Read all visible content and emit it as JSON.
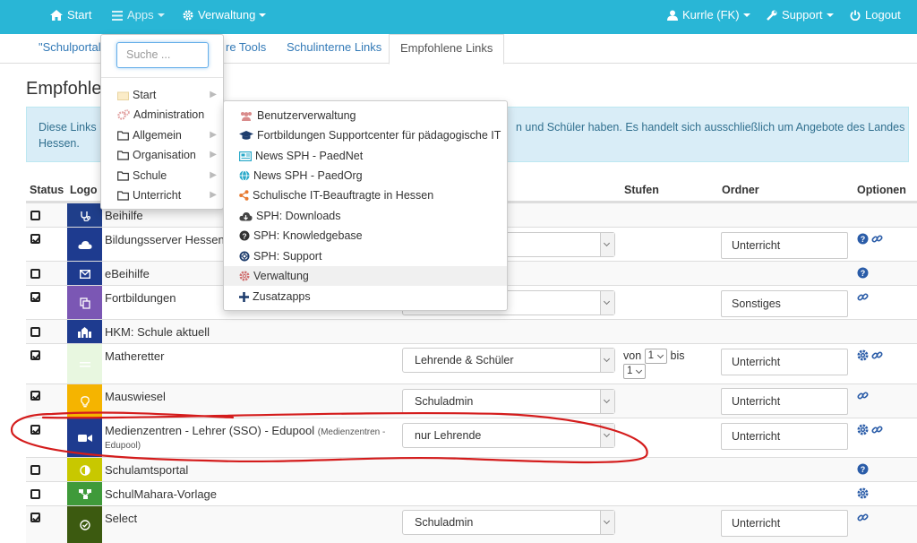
{
  "navbar": {
    "start": "Start",
    "apps": "Apps",
    "verwaltung": "Verwaltung",
    "user": "Kurrle (FK)",
    "support": "Support",
    "logout": "Logout"
  },
  "tabs": [
    {
      "label": "\"Schulportal I"
    },
    {
      "label": "re Tools"
    },
    {
      "label": "Schulinterne Links"
    },
    {
      "label": "Empfohlene Links"
    }
  ],
  "page": {
    "title": "Empfohle",
    "info_line1": "Diese Links k",
    "info_line1_right": "n und Schüler haben. Es handelt sich ausschließlich um Angebote des Landes",
    "info_line2": "Hessen."
  },
  "table": {
    "headers": {
      "status": "Status",
      "logo": "Logo",
      "stufen": "Stufen",
      "ordner": "Ordner",
      "optionen": "Optionen"
    },
    "rows": [
      {
        "name": "Beihilfe",
        "checked": false,
        "logo_color": "#1f3e8a"
      },
      {
        "name": "Bildungsserver Hessen",
        "checked": true,
        "logo_color": "#1e3b8f",
        "ordner": "Unterricht"
      },
      {
        "name": "eBeihilfe",
        "checked": false,
        "logo_color": "#1e3b8f"
      },
      {
        "name": "Fortbildungen",
        "checked": true,
        "logo_color": "#7b57b4",
        "ordner": "Sonstiges"
      },
      {
        "name": "HKM: Schule aktuell",
        "checked": false,
        "logo_color": "#1e3b8f"
      },
      {
        "name": "Matheretter",
        "checked": true,
        "logo_color": "#e8f7e0",
        "access": "Lehrende & Schüler",
        "stufen_von_label": "von",
        "stufen_von": "1",
        "stufen_bis_label": "bis",
        "stufen_bis": "1",
        "ordner": "Unterricht"
      },
      {
        "name": "Mauswiesel",
        "checked": true,
        "logo_color": "#f5b400",
        "access": "Schuladmin",
        "ordner": "Unterricht"
      },
      {
        "name": "Medienzentren - Lehrer (SSO) - Edupool",
        "sub": "(Medienzentren -",
        "sub2": "Edupool)",
        "checked": true,
        "logo_color": "#1e3b8f",
        "access": "nur Lehrende",
        "ordner": "Unterricht"
      },
      {
        "name": "Schulamtsportal",
        "checked": false,
        "logo_color": "#c8c800"
      },
      {
        "name": "SchulMahara-Vorlage",
        "checked": false,
        "logo_color": "#3f9a3a"
      },
      {
        "name": "Select",
        "checked": true,
        "logo_color": "#3c5a10",
        "access": "Schuladmin",
        "ordner": "Unterricht"
      }
    ]
  },
  "apps_menu": {
    "search_placeholder": "Suche ...",
    "items": [
      {
        "label": "Start",
        "icon": "home-icon"
      },
      {
        "label": "Administration",
        "icon": "gears-icon"
      },
      {
        "label": "Allgemein",
        "icon": "folder-icon"
      },
      {
        "label": "Organisation",
        "icon": "folder-icon"
      },
      {
        "label": "Schule",
        "icon": "folder-icon"
      },
      {
        "label": "Unterricht",
        "icon": "folder-icon"
      }
    ]
  },
  "submenu": {
    "items": [
      {
        "label": "Benutzerverwaltung",
        "icon": "users-icon"
      },
      {
        "label": "Fortbildungen Supportcenter für pädagogische IT",
        "icon": "graduation-cap-icon"
      },
      {
        "label": "News SPH - PaedNet",
        "icon": "newspaper-icon"
      },
      {
        "label": "News SPH - PaedOrg",
        "icon": "globe-icon"
      },
      {
        "label": "Schulische IT-Beauftragte in Hessen",
        "icon": "share-icon"
      },
      {
        "label": "SPH: Downloads",
        "icon": "cloud-download-icon"
      },
      {
        "label": "SPH: Knowledgebase",
        "icon": "question-icon"
      },
      {
        "label": "SPH: Support",
        "icon": "lifebuoy-icon"
      },
      {
        "label": "Verwaltung",
        "icon": "gear-icon"
      },
      {
        "label": "Zusatzapps",
        "icon": "plus-icon"
      }
    ]
  },
  "colors": {
    "navbar": "#29b6d6",
    "link": "#337ab7",
    "info_bg": "#d9edf7",
    "annotation": "#d41c1c"
  }
}
